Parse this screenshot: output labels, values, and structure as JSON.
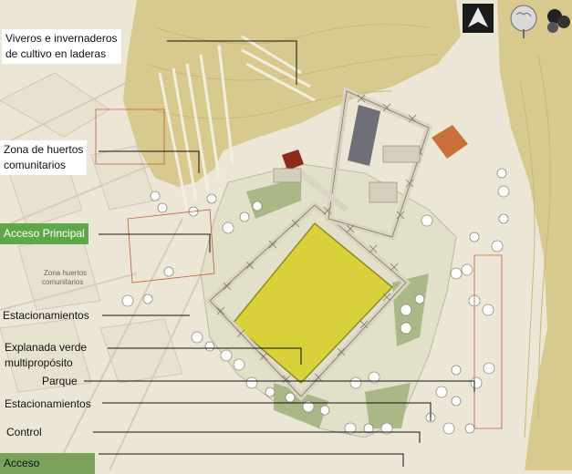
{
  "labels": {
    "viveros": "Viveros e invernaderos\nde cultivo en laderas",
    "huertos": "Zona de huertos\ncomunitarios",
    "acceso_principal": "Acceso Principal",
    "estacionamientos_1": "Estacionamientos",
    "explanada": "Explanada verde\nmultipropósito",
    "parque": "Parque",
    "estacionamientos_2": "Estacionamientos",
    "control": "Control",
    "acceso": "Acceso",
    "map_huertos_text": "Zona huertos\ncomunitarios"
  },
  "colors": {
    "background": "#ece6d6",
    "hillside": "#d8c98e",
    "plaza": "#e2e0c9",
    "field": "#d8d13a",
    "green_areas": "#9fb07a",
    "roof_gray": "#6f7077",
    "roof_red": "#8e2a1c",
    "roof_orange": "#c9713b",
    "acceso_principal": "#5fa84a",
    "acceso": "#7aa25a"
  },
  "icons": {
    "compass": "north-arrow-icon",
    "trees": "tree-legend-icon"
  }
}
